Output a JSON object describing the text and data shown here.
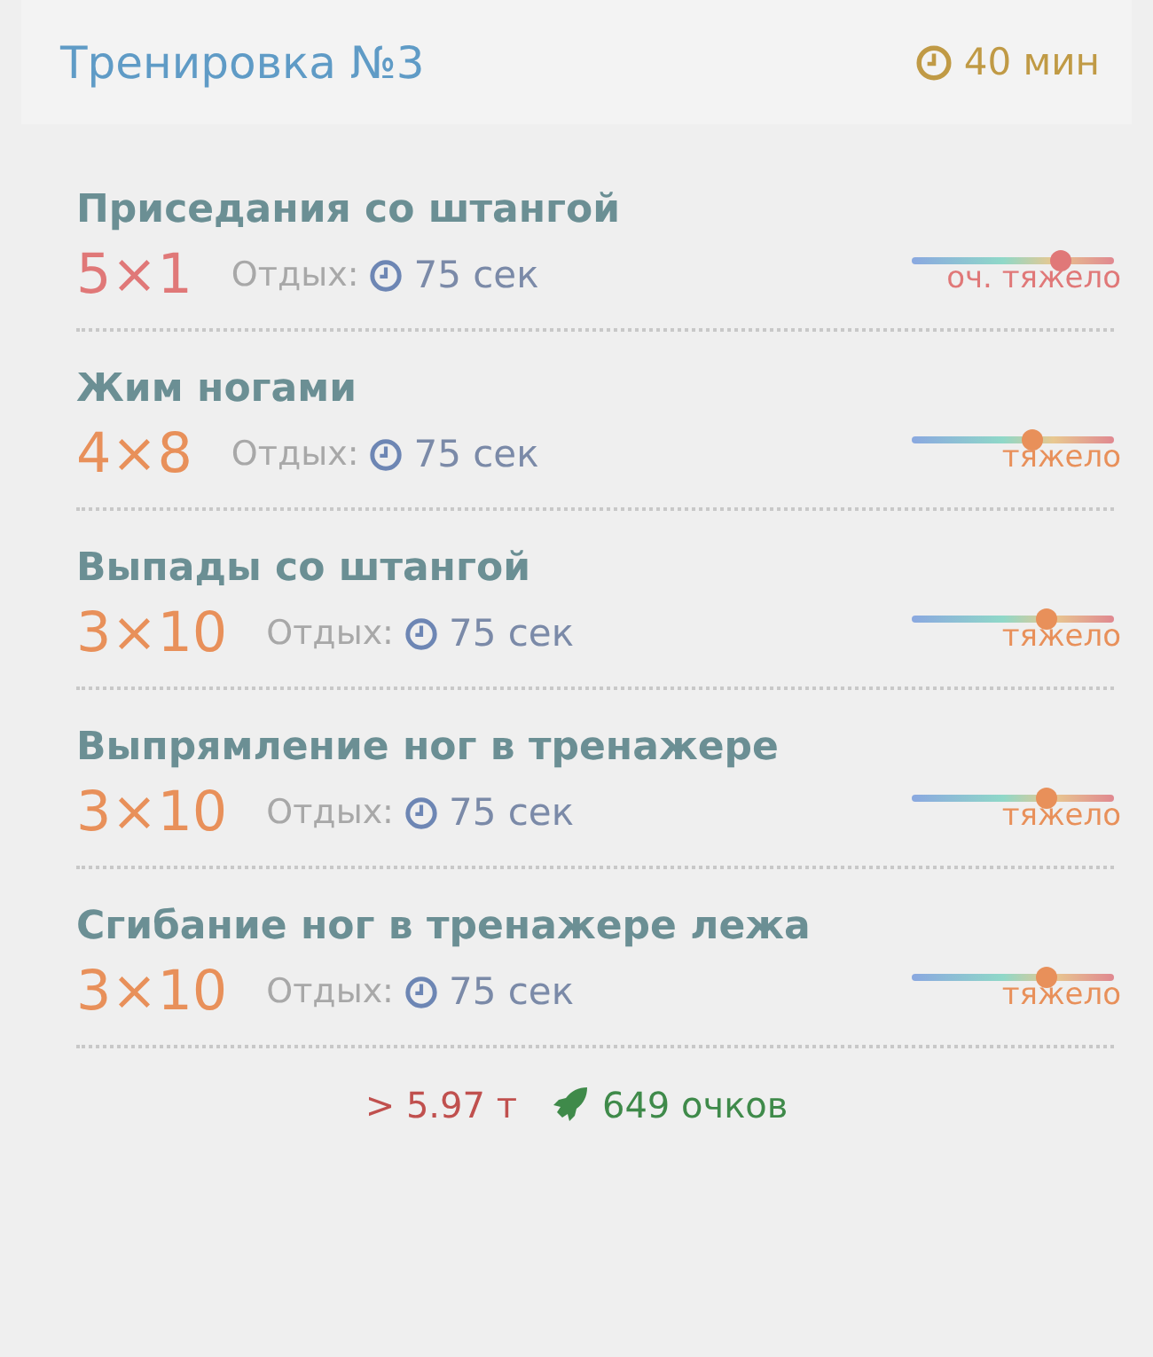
{
  "header": {
    "title": "Тренировка №3",
    "duration": "40 мин"
  },
  "exercises": [
    {
      "name": "Приседания со штангой",
      "sets": "5×1",
      "rest_label": "Отдых:",
      "rest": "75 сек",
      "level": 0.74,
      "intensity": "оч. тяжело",
      "color": "#e07878"
    },
    {
      "name": "Жим ногами",
      "sets": "4×8",
      "rest_label": "Отдых:",
      "rest": "75 сек",
      "level": 0.6,
      "intensity": "тяжело",
      "color": "#e8905a"
    },
    {
      "name": "Выпады со штангой",
      "sets": "3×10",
      "rest_label": "Отдых:",
      "rest": "75 сек",
      "level": 0.67,
      "intensity": "тяжело",
      "color": "#e8905a"
    },
    {
      "name": "Выпрямление ног в тренажере",
      "sets": "3×10",
      "rest_label": "Отдых:",
      "rest": "75 сек",
      "level": 0.67,
      "intensity": "тяжело",
      "color": "#e8905a"
    },
    {
      "name": "Сгибание ног в тренажере лежа",
      "sets": "3×10",
      "rest_label": "Отдых:",
      "rest": "75 сек",
      "level": 0.67,
      "intensity": "тяжело",
      "color": "#e8905a"
    }
  ],
  "footer": {
    "tonnage": "> 5.97 т",
    "points": "649 очков"
  }
}
